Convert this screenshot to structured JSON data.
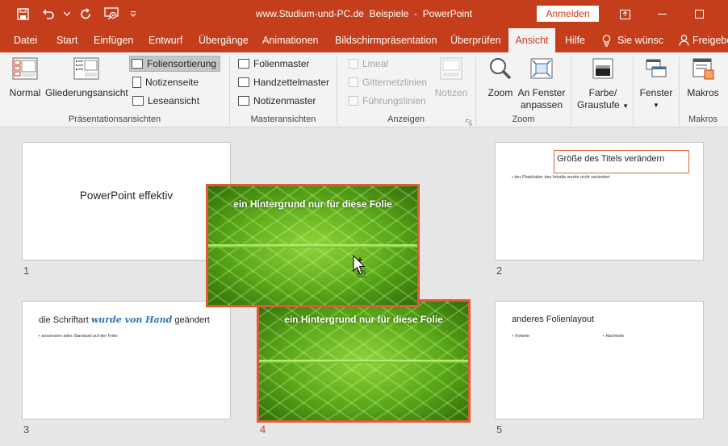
{
  "titlebar": {
    "site": "www.Studium-und-PC.de",
    "doc": "Beispiele",
    "dash": "-",
    "app": "PowerPoint",
    "signin": "Anmelden"
  },
  "tabs": [
    {
      "label": "Datei"
    },
    {
      "label": "Start"
    },
    {
      "label": "Einfügen"
    },
    {
      "label": "Entwurf"
    },
    {
      "label": "Übergänge"
    },
    {
      "label": "Animationen"
    },
    {
      "label": "Bildschirmpräsentation"
    },
    {
      "label": "Überprüfen"
    },
    {
      "label": "Ansicht"
    },
    {
      "label": "Hilfe"
    }
  ],
  "tellme": "Sie wünsc",
  "share": "Freigeben",
  "ribbon": {
    "praes": {
      "normal": "Normal",
      "gliederung": "Gliederungsansicht",
      "foliensortierung": "Foliensortierung",
      "notizenseite": "Notizenseite",
      "leseansicht": "Leseansicht",
      "label": "Präsentationsansichten"
    },
    "master": {
      "folienmaster": "Folienmaster",
      "handzettelmaster": "Handzettelmaster",
      "notizenmaster": "Notizenmaster",
      "label": "Masteransichten"
    },
    "anzeigen": {
      "lineal": "Lineal",
      "gitternetz": "Gitternetzlinien",
      "fuehrung": "Führungslinien",
      "notizen": "Notizen",
      "label": "Anzeigen"
    },
    "zoom": {
      "zoom": "Zoom",
      "fenster1": "An Fenster",
      "fenster2": "anpassen",
      "label": "Zoom"
    },
    "farbe": {
      "l1": "Farbe/",
      "l2": "Graustufe"
    },
    "fenster": {
      "label": "Fenster"
    },
    "makros": {
      "btn": "Makros",
      "label": "Makros"
    }
  },
  "slides": {
    "s1": {
      "title": "PowerPoint effektiv",
      "num": "1"
    },
    "s2": {
      "title": "Größe des Titels verändern",
      "bullet": "• der Platzhalter des Inhalts wurde nicht verändert",
      "num": "2"
    },
    "s3": {
      "pre": "die Schriftart ",
      "hand": "wurde von Hand",
      "post": " geändert",
      "bullet": "• ansonsten alles Standard auf der Folie",
      "num": "3"
    },
    "s4": {
      "title": "ein Hintergrund nur für diese Folie",
      "num": "4"
    },
    "s5": {
      "title": "anderes Folienlayout",
      "b1": "• Vorteile",
      "b2": "• Nachteile",
      "num": "5"
    },
    "drag": {
      "title": "ein Hintergrund nur für diese Folie"
    }
  },
  "colors": {
    "accent": "#c43e1c",
    "selection": "#e25a35"
  }
}
